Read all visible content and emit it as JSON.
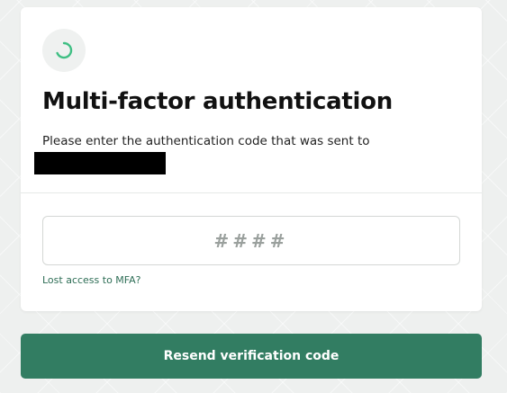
{
  "mfa": {
    "title": "Multi-factor authentication",
    "description": "Please enter the authentication code that was sent to",
    "code_placeholder": "####",
    "lost_access_label": "Lost access to MFA?",
    "resend_label": "Resend verification code",
    "spinner_icon": "loading-spinner-icon"
  },
  "colors": {
    "accent": "#327d62",
    "link": "#2e6e56",
    "spinner": "#3fbf83"
  }
}
